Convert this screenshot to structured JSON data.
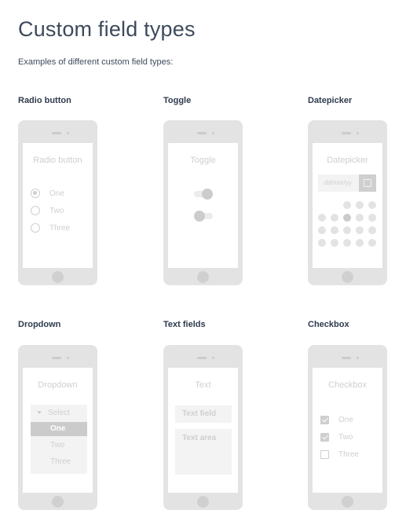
{
  "page": {
    "title": "Custom field types",
    "subtitle": "Examples of different custom field types:"
  },
  "sections": {
    "radio": {
      "label": "Radio button",
      "screen_title": "Radio button",
      "options": [
        "One",
        "Two",
        "Three"
      ],
      "selected_index": 0
    },
    "toggle": {
      "label": "Toggle",
      "screen_title": "Toggle",
      "states": [
        "on",
        "off"
      ]
    },
    "datepicker": {
      "label": "Datepicker",
      "screen_title": "Datepicker",
      "placeholder": "dd/mm/yy",
      "icon": "calendar-icon"
    },
    "dropdown": {
      "label": "Dropdown",
      "screen_title": "Dropdown",
      "select_label": "Select",
      "options": [
        "One",
        "Two",
        "Three"
      ],
      "selected_index": 0
    },
    "text": {
      "label": "Text fields",
      "screen_title": "Text",
      "text_field": "Text field",
      "text_area": "Text area"
    },
    "checkbox": {
      "label": "Checkbox",
      "screen_title": "Checkbox",
      "options": [
        "One",
        "Two",
        "Three"
      ],
      "checked": [
        true,
        true,
        false
      ]
    }
  },
  "colors": {
    "heading": "#3d4a5c",
    "phone_body": "#e3e3e3",
    "placeholder_gray": "#cfcfcf"
  }
}
